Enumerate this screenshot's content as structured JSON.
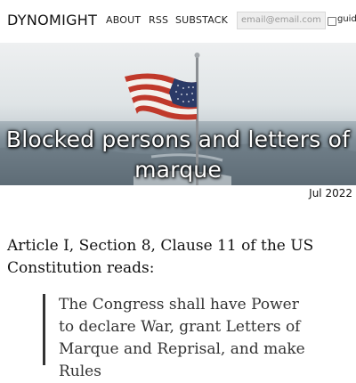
{
  "site": {
    "brand": "DYNOMIGHT",
    "nav": [
      "ABOUT",
      "RSS",
      "SUBSTACK"
    ],
    "email_placeholder": "email@email.com",
    "checkbox_label": "guid"
  },
  "hero": {
    "title": "Blocked persons and letters of marque"
  },
  "post": {
    "date": "Jul 2022",
    "intro": "Article I, Section 8, Clause 11 of the US Constitution reads:",
    "quote": "The Congress shall have Power to declare War, grant Letters of Marque and Reprisal, and make Rules"
  }
}
